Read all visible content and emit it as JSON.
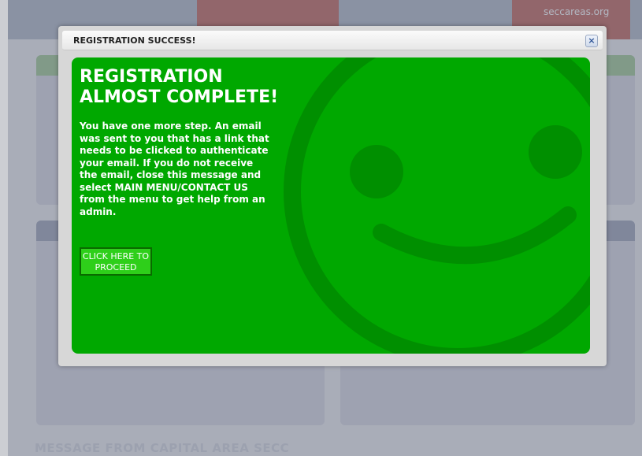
{
  "background": {
    "site_url": "seccareas.org",
    "footer_heading": "MESSAGE FROM CAPITAL AREA SECC"
  },
  "modal": {
    "title": "REGISTRATION SUCCESS!",
    "close_glyph": "×",
    "headline": "REGISTRATION ALMOST COMPLETE!",
    "body": "You have one more step. An email was sent to you that has a link that needs to be clicked to authenticate your email. If you do not receive the email, close this message and select MAIN MENU/CONTACT US from the menu to get help from an admin.",
    "proceed_button_label": "CLICK HERE TO PROCEED",
    "icon": "smiley-face-icon"
  },
  "colors": {
    "panel_green": "#00a800",
    "smiley_green": "#008f00",
    "button_green": "#2ecf1a"
  }
}
